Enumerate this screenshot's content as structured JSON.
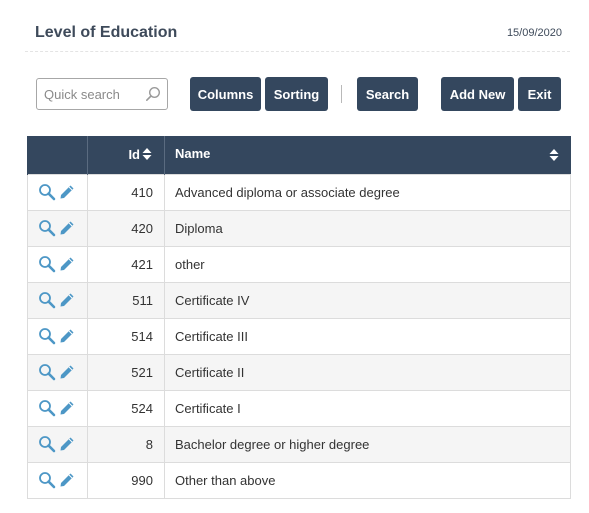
{
  "header": {
    "title": "Level of Education",
    "date": "15/09/2020"
  },
  "toolbar": {
    "search_placeholder": "Quick search",
    "search_value": "",
    "columns_label": "Columns",
    "sorting_label": "Sorting",
    "search_label": "Search",
    "add_new_label": "Add New",
    "exit_label": "Exit"
  },
  "table": {
    "columns": {
      "id": "Id",
      "name": "Name"
    },
    "rows": [
      {
        "id": "410",
        "name": "Advanced diploma or associate degree"
      },
      {
        "id": "420",
        "name": "Diploma"
      },
      {
        "id": "421",
        "name": "other"
      },
      {
        "id": "511",
        "name": "Certificate IV"
      },
      {
        "id": "514",
        "name": "Certificate III"
      },
      {
        "id": "521",
        "name": "Certificate II"
      },
      {
        "id": "524",
        "name": "Certificate I"
      },
      {
        "id": "8",
        "name": "Bachelor degree or higher degree"
      },
      {
        "id": "990",
        "name": "Other than above"
      }
    ]
  },
  "icons": {
    "search": "search-icon",
    "sort": "sort-both-icon",
    "view": "magnifier-icon",
    "edit": "pencil-icon"
  },
  "colors": {
    "header_bg": "#34475e",
    "button_bg": "#34475e",
    "action_icon": "#4d97c6",
    "title_text": "#3e4a5a"
  }
}
